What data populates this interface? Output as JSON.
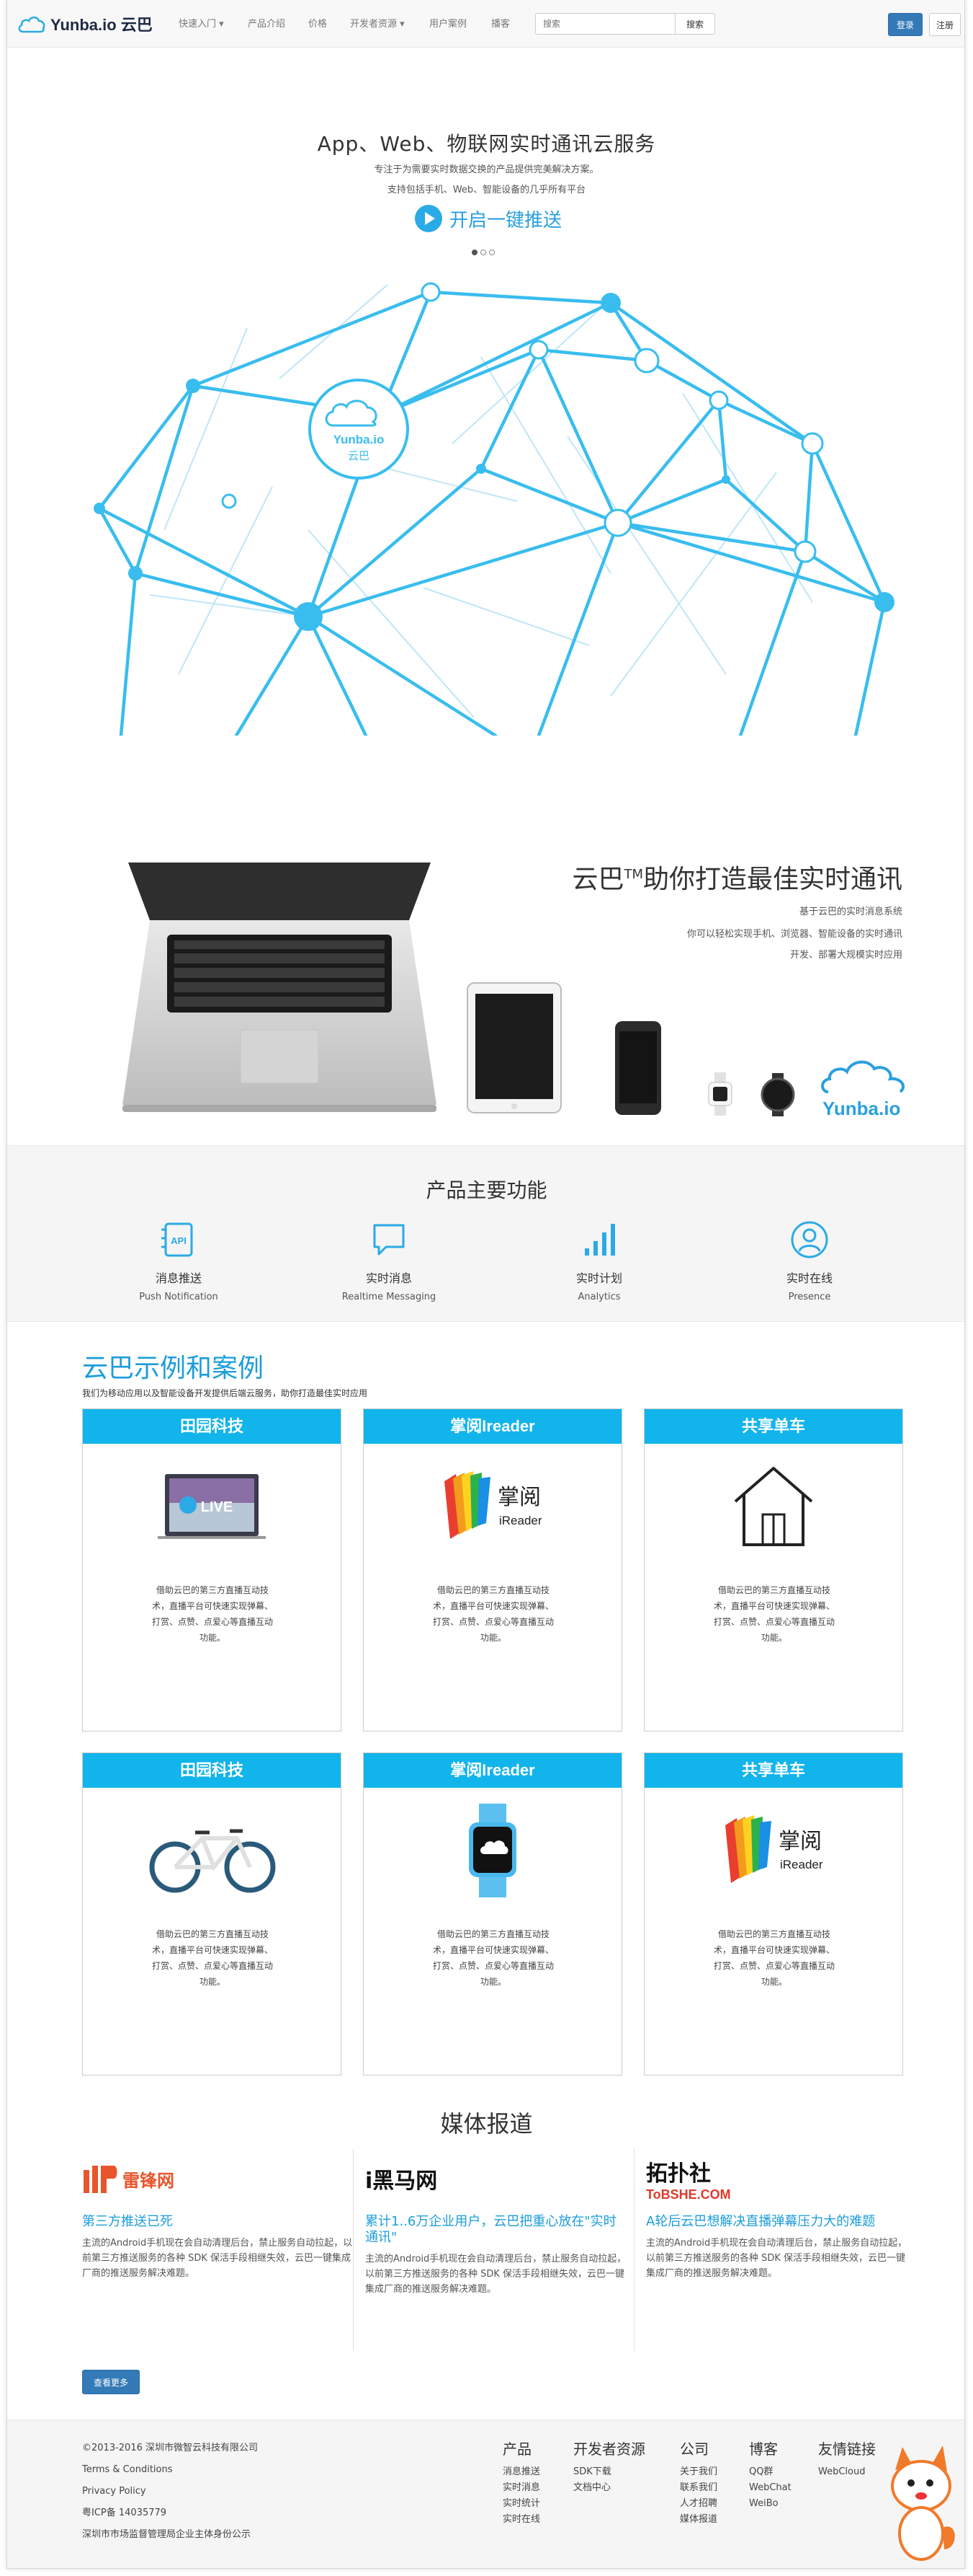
{
  "nav": {
    "logo_text": "Yunba.io 云巴",
    "items": [
      "快速入门",
      "产品介绍",
      "价格",
      "开发者资源",
      "用户案例",
      "播客"
    ],
    "search_placeholder": "搜索",
    "search_btn": "搜索",
    "login": "登录",
    "register": "注册"
  },
  "hero": {
    "title": "App、Web、物联网实时通讯云服务",
    "sub1": "专注于为需要实时数据交换的产品提供完美解决方案。",
    "sub2": "支持包括手机、Web、智能设备的几乎所有平台",
    "cta": "开启一键推送",
    "globe_logo_en": "Yunba.io",
    "globe_logo_zh": "云巴"
  },
  "devices": {
    "title_a": "云巴",
    "title_sup": "TM",
    "title_b": "助你打造最佳实时通讯",
    "line1": "基于云巴的实时消息系统",
    "line2": "你可以轻松实现手机、浏览器、智能设备的实时通讯",
    "line3": "开发、部署大规模实时应用",
    "brand": "Yunba.io"
  },
  "features": {
    "heading": "产品主要功能",
    "items": [
      {
        "zh": "消息推送",
        "en": "Push Notification",
        "icon": "api-document-icon"
      },
      {
        "zh": "实时消息",
        "en": "Realtime Messaging",
        "icon": "chat-bubble-icon"
      },
      {
        "zh": "实时计划",
        "en": "Analytics",
        "icon": "bar-chart-icon"
      },
      {
        "zh": "实时在线",
        "en": "Presence",
        "icon": "user-icon"
      }
    ]
  },
  "cases": {
    "title": "云巴示例和案例",
    "subtitle": "我们为移动应用以及智能设备开发提供后端云服务，助你打造最佳实时应用",
    "body_l1": "借助云巴的第三方直播互动技",
    "body_l2": "术，直播平台可快速实现弹幕、",
    "body_l3": "打赏、点赞、点爱心等直播互动",
    "body_l4": "功能。",
    "cards": [
      {
        "title": "田园科技",
        "image": "laptop-live"
      },
      {
        "title": "掌阅Ireader",
        "image": "ireader-logo"
      },
      {
        "title": "共享单车",
        "image": "house-icon"
      },
      {
        "title": "田园科技",
        "image": "bicycle"
      },
      {
        "title": "掌阅Ireader",
        "image": "smartwatch"
      },
      {
        "title": "共享单车",
        "image": "ireader-logo"
      }
    ],
    "ireader_zh": "掌阅",
    "ireader_en": "iReader",
    "live_label": "LIVE"
  },
  "media": {
    "heading": "媒体报道",
    "logos": [
      "雷锋网",
      "i黑马网",
      "拓扑社"
    ],
    "logo_sub": "ToBSHE.COM",
    "items": [
      {
        "title": "第三方推送已死",
        "body": "主流的Android手机现在会自动清理后台，禁止服务自动拉起，以前第三方推送服务的各种 SDK 保活手段相继失效，云巴一键集成厂商的推送服务解决难题。"
      },
      {
        "title": "累计1..6万企业用户，云巴把重心放在\"实时通讯\"",
        "body": "主流的Android手机现在会自动清理后台，禁止服务自动拉起，以前第三方推送服务的各种 SDK 保活手段相继失效，云巴一键集成厂商的推送服务解决难题。"
      },
      {
        "title": "A轮后云巴想解决直播弹幕压力大的难题",
        "body": "主流的Android手机现在会自动清理后台，禁止服务自动拉起，以前第三方推送服务的各种 SDK 保活手段相继失效，云巴一键集成厂商的推送服务解决难题。"
      }
    ],
    "more": "查看更多"
  },
  "footer": {
    "left": [
      "©2013-2016 深圳市微智云科技有限公司",
      "Terms & Conditions",
      "Privacy Policy",
      "粤ICP备 14035779",
      "深圳市市场监督管理局企业主体身份公示"
    ],
    "cols": [
      {
        "head": "产品",
        "links": [
          "消息推送",
          "实时消息",
          "实时统计",
          "实时在线"
        ]
      },
      {
        "head": "开发者资源",
        "links": [
          "SDK下载",
          "文档中心"
        ]
      },
      {
        "head": "公司",
        "links": [
          "关于我们",
          "联系我们",
          "人才招聘",
          "媒体报道"
        ]
      },
      {
        "head": "博客",
        "links": [
          "QQ群",
          "WebChat",
          "WeiBo"
        ]
      },
      {
        "head": "友情链接",
        "links": [
          "WebCloud"
        ]
      }
    ]
  },
  "colors": {
    "accent": "#12b4ec",
    "link": "#1c9ddb",
    "button": "#337ab7",
    "globe": "#3bbcec"
  }
}
